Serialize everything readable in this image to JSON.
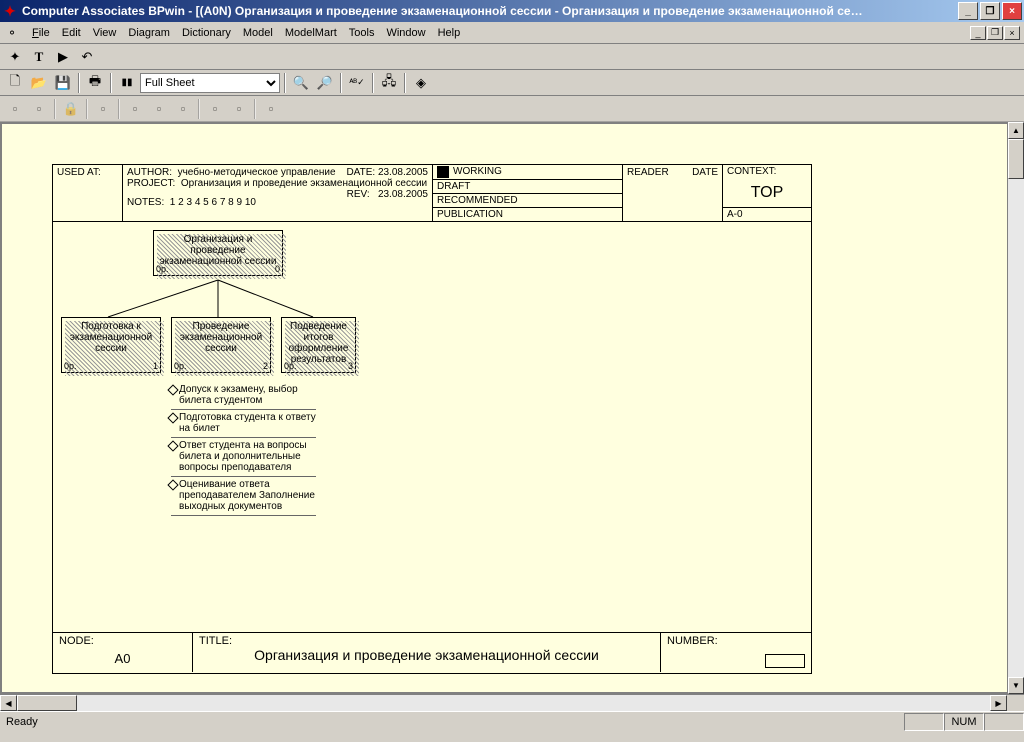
{
  "title": "Computer Associates BPwin - [(A0N) Организация и проведение  экзаменационной сессии   - Организация и проведение экзаменационной се…",
  "menu": {
    "file": "File",
    "edit": "Edit",
    "view": "View",
    "diagram": "Diagram",
    "dictionary": "Dictionary",
    "model": "Model",
    "modelmart": "ModelMart",
    "tools": "Tools",
    "window": "Window",
    "help": "Help"
  },
  "zoom_value": "Full Sheet",
  "status": {
    "ready": "Ready",
    "num": "NUM"
  },
  "sheet": {
    "used_at": "USED AT:",
    "author_label": "AUTHOR:",
    "author": "учебно-методическое управление",
    "project_label": "PROJECT:",
    "project": "Организация и проведение экзаменационной сессии",
    "notes_label": "NOTES:",
    "notes": "1  2  3  4  5  6  7  8  9  10",
    "date_label": "DATE:",
    "date": "23.08.2005",
    "rev_label": "REV:",
    "rev": "23.08.2005",
    "working": "WORKING",
    "draft": "DRAFT",
    "recommended": "RECOMMENDED",
    "publication": "PUBLICATION",
    "reader": "READER",
    "reader_date": "DATE",
    "context": "CONTEXT:",
    "top": "TOP",
    "a0": "A-0",
    "footer_node_label": "NODE:",
    "footer_node": "A0",
    "footer_title_label": "TITLE:",
    "footer_title": "Организация и проведение  экзаменационной сессии",
    "footer_number_label": "NUMBER:"
  },
  "boxes": {
    "root": {
      "text": "Организация и проведение экзаменационной сессии",
      "bl": "0p.",
      "br": "0"
    },
    "b1": {
      "text": "Подготовка к экзаменационной сессии",
      "bl": "0p.",
      "br": "1"
    },
    "b2": {
      "text": "Проведение экзаменационной сессии",
      "bl": "0p.",
      "br": "2"
    },
    "b3": {
      "text": "Подведение итогов оформление результатов",
      "bl": "0p.",
      "br": "3"
    }
  },
  "activities": [
    "Допуск к экзамену, выбор билета студентом",
    "Подготовка студента к ответу  на билет",
    "Ответ студента на вопросы билета и дополнительные вопросы преподавателя",
    "Оценивание ответа преподавателем Заполнение выходных документов"
  ]
}
